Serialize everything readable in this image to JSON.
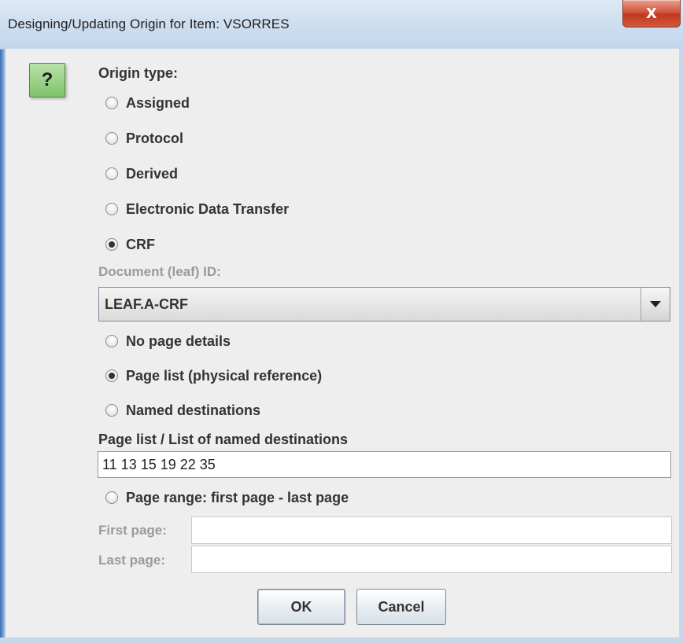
{
  "window": {
    "title": "Designing/Updating Origin for Item: VSORRES",
    "close_glyph": "X",
    "help_glyph": "?"
  },
  "origin_type": {
    "label": "Origin type:",
    "options": [
      {
        "label": "Assigned",
        "selected": false
      },
      {
        "label": "Protocol",
        "selected": false
      },
      {
        "label": "Derived",
        "selected": false
      },
      {
        "label": "Electronic Data Transfer",
        "selected": false
      },
      {
        "label": "CRF",
        "selected": true
      }
    ]
  },
  "document": {
    "label": "Document (leaf) ID:",
    "selected_value": "LEAF.A-CRF"
  },
  "page_details": {
    "options": [
      {
        "label": "No page details",
        "selected": false
      },
      {
        "label": "Page list (physical reference)",
        "selected": true
      },
      {
        "label": "Named destinations",
        "selected": false
      }
    ],
    "list_label": "Page list / List of named destinations",
    "list_value": "11 13 15 19 22 35",
    "range_option": {
      "label": "Page range: first page - last page",
      "selected": false
    },
    "first_page_label": "First page:",
    "first_page_value": "",
    "last_page_label": "Last page:",
    "last_page_value": ""
  },
  "buttons": {
    "ok": "OK",
    "cancel": "Cancel"
  },
  "colors": {
    "titlebar": "#cfdff0",
    "close_button": "#c9432a",
    "dialog_background": "#eeeeee",
    "help_icon": "#8fcb7b"
  }
}
